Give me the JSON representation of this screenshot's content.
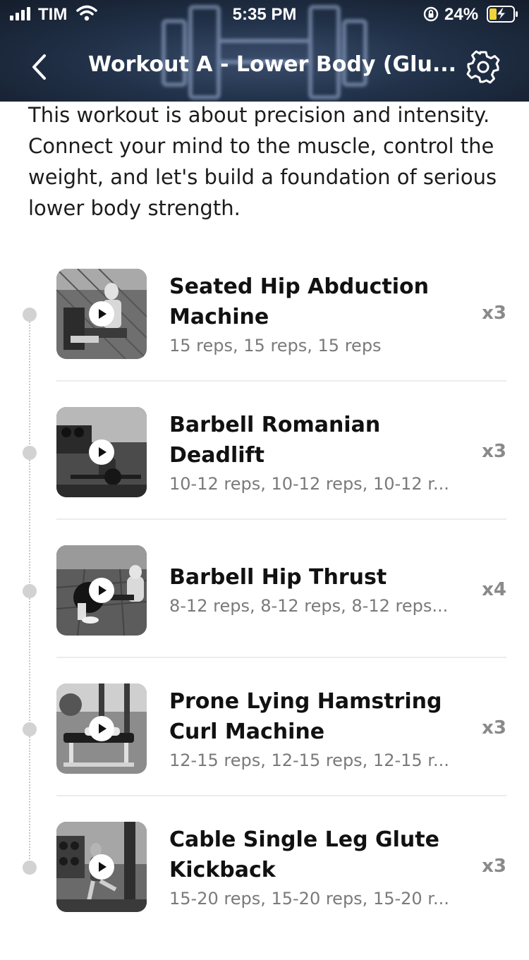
{
  "status_bar": {
    "carrier": "TIM",
    "time": "5:35 PM",
    "battery_percent": "24%"
  },
  "nav": {
    "title": "Workout A - Lower Body (Glu..."
  },
  "description": "This workout is about precision and intensity. Connect your mind to the muscle, control the weight, and let's build a foundation of serious lower body strength.",
  "exercises": [
    {
      "name": "Seated Hip Abduction Machine",
      "reps": "15 reps, 15 reps, 15 reps",
      "sets": "x3"
    },
    {
      "name": "Barbell Romanian Deadlift",
      "reps": "10-12 reps, 10-12 reps, 10-12 r...",
      "sets": "x3"
    },
    {
      "name": "Barbell Hip Thrust",
      "reps": "8-12 reps, 8-12 reps, 8-12 reps...",
      "sets": "x4"
    },
    {
      "name": "Prone Lying Hamstring Curl Machine",
      "reps": "12-15 reps, 12-15 reps, 12-15 r...",
      "sets": "x3"
    },
    {
      "name": "Cable Single Leg Glute Kickback",
      "reps": "15-20 reps, 15-20 reps, 15-20 r...",
      "sets": "x3"
    }
  ]
}
